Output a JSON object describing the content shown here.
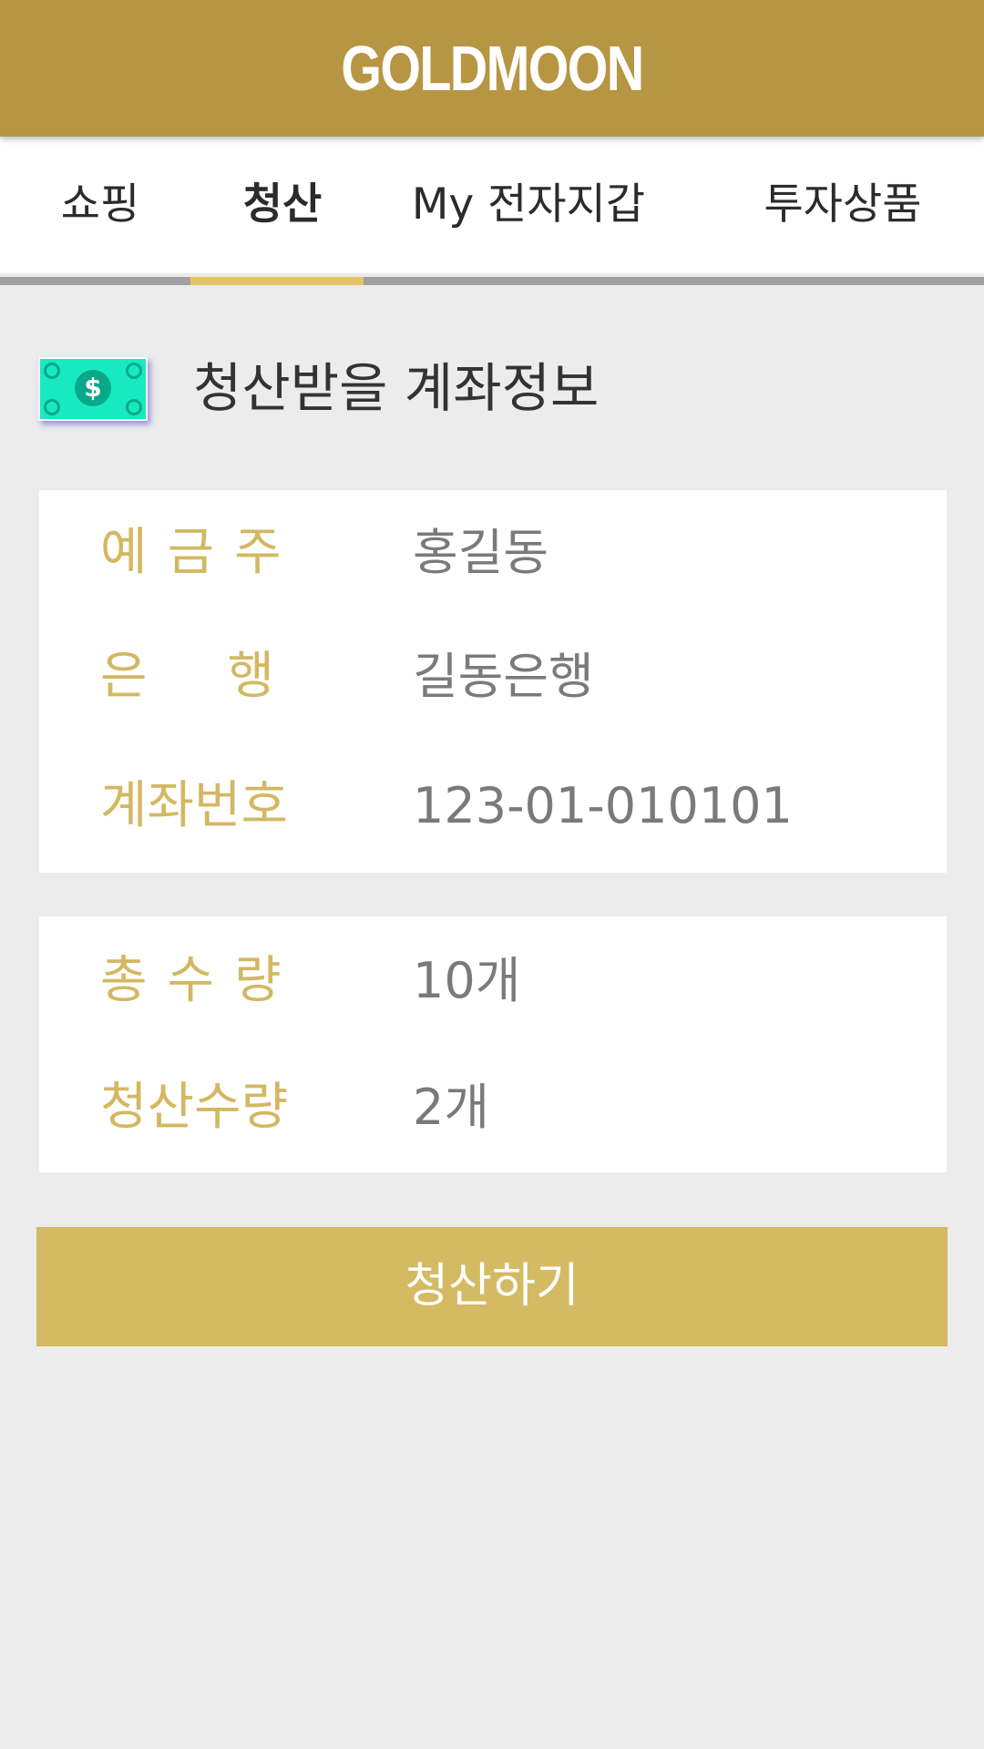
{
  "header": {
    "logo": "GOLDMOON"
  },
  "tabs": [
    {
      "label": "쇼핑"
    },
    {
      "label": "청산"
    },
    {
      "label": "My 전자지갑"
    },
    {
      "label": "투자상품"
    }
  ],
  "active_tab": "청산",
  "section": {
    "icon": "money-bill-icon",
    "title": "청산받을 계좌정보"
  },
  "account": {
    "holder_label": "예금주",
    "holder_value": "홍길동",
    "bank_label": "은행",
    "bank_value": "길동은행",
    "number_label": "계좌번호",
    "number_value": "123-01-010101"
  },
  "quantity": {
    "total_label": "총수량",
    "total_value": "10개",
    "settle_label": "청산수량",
    "settle_value": "2개"
  },
  "actions": {
    "settle_button": "청산하기"
  },
  "colors": {
    "header": "#b69643",
    "accent_label": "#d3b862",
    "button": "#d4ba62",
    "tab_indicator": "#e4c565",
    "money_icon": "#17eac0"
  }
}
